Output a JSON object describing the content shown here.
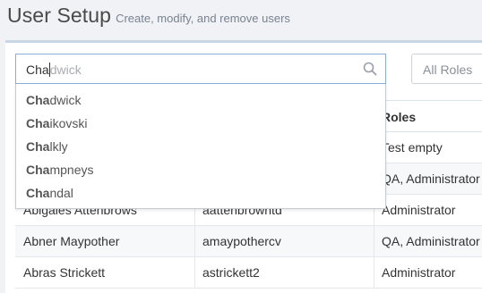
{
  "header": {
    "title": "User Setup",
    "subtitle": "Create, modify, and remove users"
  },
  "search": {
    "typed": "Cha",
    "ghost": "dwick",
    "icon": "search-icon"
  },
  "roles_filter": {
    "selected": "All Roles"
  },
  "table": {
    "columns": {
      "roles": "Roles"
    },
    "rows": [
      {
        "name": "",
        "username": "",
        "roles": "Test empty"
      },
      {
        "name": "",
        "username": "",
        "roles": "QA, Administrator"
      },
      {
        "name": "Abigales Attenbrows",
        "username": "aattenbrowntd",
        "roles": "Administrator"
      },
      {
        "name": "Abner Maypother",
        "username": "amaypothercv",
        "roles": "QA, Administrator"
      },
      {
        "name": "Abras Strickett",
        "username": "astrickett2",
        "roles": "Administrator"
      }
    ]
  },
  "suggestions": [
    {
      "match": "Cha",
      "rest": "dwick"
    },
    {
      "match": "Cha",
      "rest": "ikovski"
    },
    {
      "match": "Cha",
      "rest": "lkly"
    },
    {
      "match": "Cha",
      "rest": "mpneys"
    },
    {
      "match": "Cha",
      "rest": "ndal"
    }
  ]
}
